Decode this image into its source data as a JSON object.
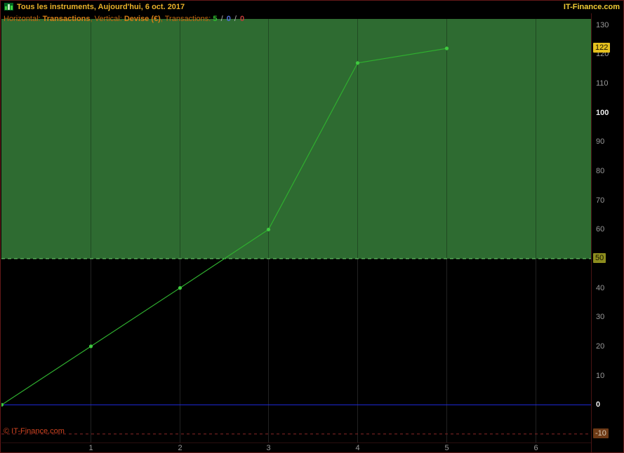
{
  "header": {
    "title": "Tous les instruments, Aujourd'hui, 6 oct. 2017",
    "brand": "IT-Finance.com"
  },
  "infobar": {
    "horizontal_label": "Horizontal:",
    "horizontal_value": "Transactions",
    "comma": ",",
    "vertical_label": "Vertical:",
    "vertical_value": "Devise (€)",
    "transactions_label": "Transactions:",
    "count_green": "5",
    "count_blue": "0",
    "count_red": "0",
    "separator": "/"
  },
  "plot": {
    "copyright": "© IT-Finance.com"
  },
  "chart_data": {
    "type": "line",
    "title": "Tous les instruments, Aujourd'hui, 6 oct. 2017",
    "xlabel": "Transactions",
    "ylabel": "Devise (€)",
    "x": [
      0,
      1,
      2,
      3,
      4,
      5
    ],
    "values": [
      0,
      20,
      40,
      60,
      117,
      122
    ],
    "x_ticks": [
      1,
      2,
      3,
      4,
      5,
      6
    ],
    "y_ticks": [
      -10,
      0,
      10,
      20,
      30,
      40,
      50,
      60,
      70,
      80,
      90,
      100,
      110,
      120,
      130
    ],
    "bold_ticks": [
      0,
      100
    ],
    "badge_ticks": {
      "50": "badge-olive",
      "-10": "badge-dark"
    },
    "last_price": 122,
    "zone_boundary": 50,
    "zero_line": 0,
    "lower_dashed_line": -10,
    "ylim": [
      -13,
      132
    ],
    "xlim": [
      0,
      6.6
    ],
    "grid": "vertical",
    "legend_position": "none",
    "colors": {
      "zone_fill": "#2e6b31",
      "zone_boundary_line": "#6fd66f",
      "line": "#2fae2f",
      "point": "#3fc93f",
      "zero_line": "#1e2ae0",
      "lower_dashed_line": "#8b2626",
      "grid_black_zone": "#222222",
      "grid_green_zone": "rgba(0,0,0,0.30)",
      "last_price_badge": "#e5c01e"
    }
  }
}
